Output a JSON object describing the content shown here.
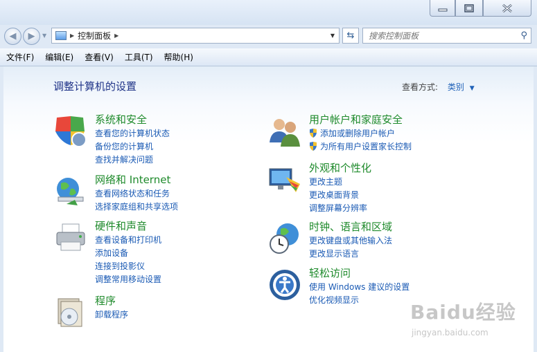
{
  "window": {
    "min_icon": "minimize-icon",
    "max_icon": "maximize-icon",
    "close_icon": "close-icon"
  },
  "address": {
    "breadcrumb": "控制面板",
    "search_placeholder": "搜索控制面板"
  },
  "menu": [
    "文件(F)",
    "编辑(E)",
    "查看(V)",
    "工具(T)",
    "帮助(H)"
  ],
  "main": {
    "heading": "调整计算机的设置",
    "view_by_label": "查看方式:",
    "view_by_value": "类别"
  },
  "categories": [
    {
      "title": "系统和安全",
      "icon": "shield-flag-icon",
      "links": [
        "查看您的计算机状态",
        "备份您的计算机",
        "查找并解决问题"
      ]
    },
    {
      "title": "网络和 Internet",
      "icon": "network-globe-icon",
      "links": [
        "查看网络状态和任务",
        "选择家庭组和共享选项"
      ]
    },
    {
      "title": "硬件和声音",
      "icon": "printer-icon",
      "links": [
        "查看设备和打印机",
        "添加设备",
        "连接到投影仪",
        "调整常用移动设置"
      ]
    },
    {
      "title": "程序",
      "icon": "programs-icon",
      "links": [
        "卸载程序"
      ]
    },
    {
      "title": "用户帐户和家庭安全",
      "icon": "users-icon",
      "links": [
        "添加或删除用户帐户",
        "为所有用户设置家长控制"
      ]
    },
    {
      "title": "外观和个性化",
      "icon": "monitor-palette-icon",
      "links": [
        "更改主题",
        "更改桌面背景",
        "调整屏幕分辨率"
      ]
    },
    {
      "title": "时钟、语言和区域",
      "icon": "clock-globe-icon",
      "links": [
        "更改键盘或其他输入法",
        "更改显示语言"
      ]
    },
    {
      "title": "轻松访问",
      "icon": "ease-of-access-icon",
      "links": [
        "使用 Windows 建议的设置",
        "优化视频显示"
      ]
    }
  ],
  "watermark": {
    "logo": "Baidu经验",
    "url": "jingyan.baidu.com"
  },
  "colors": {
    "category_title": "#1e8a2b",
    "link": "#1a5ab4",
    "heading": "#1e3287"
  }
}
